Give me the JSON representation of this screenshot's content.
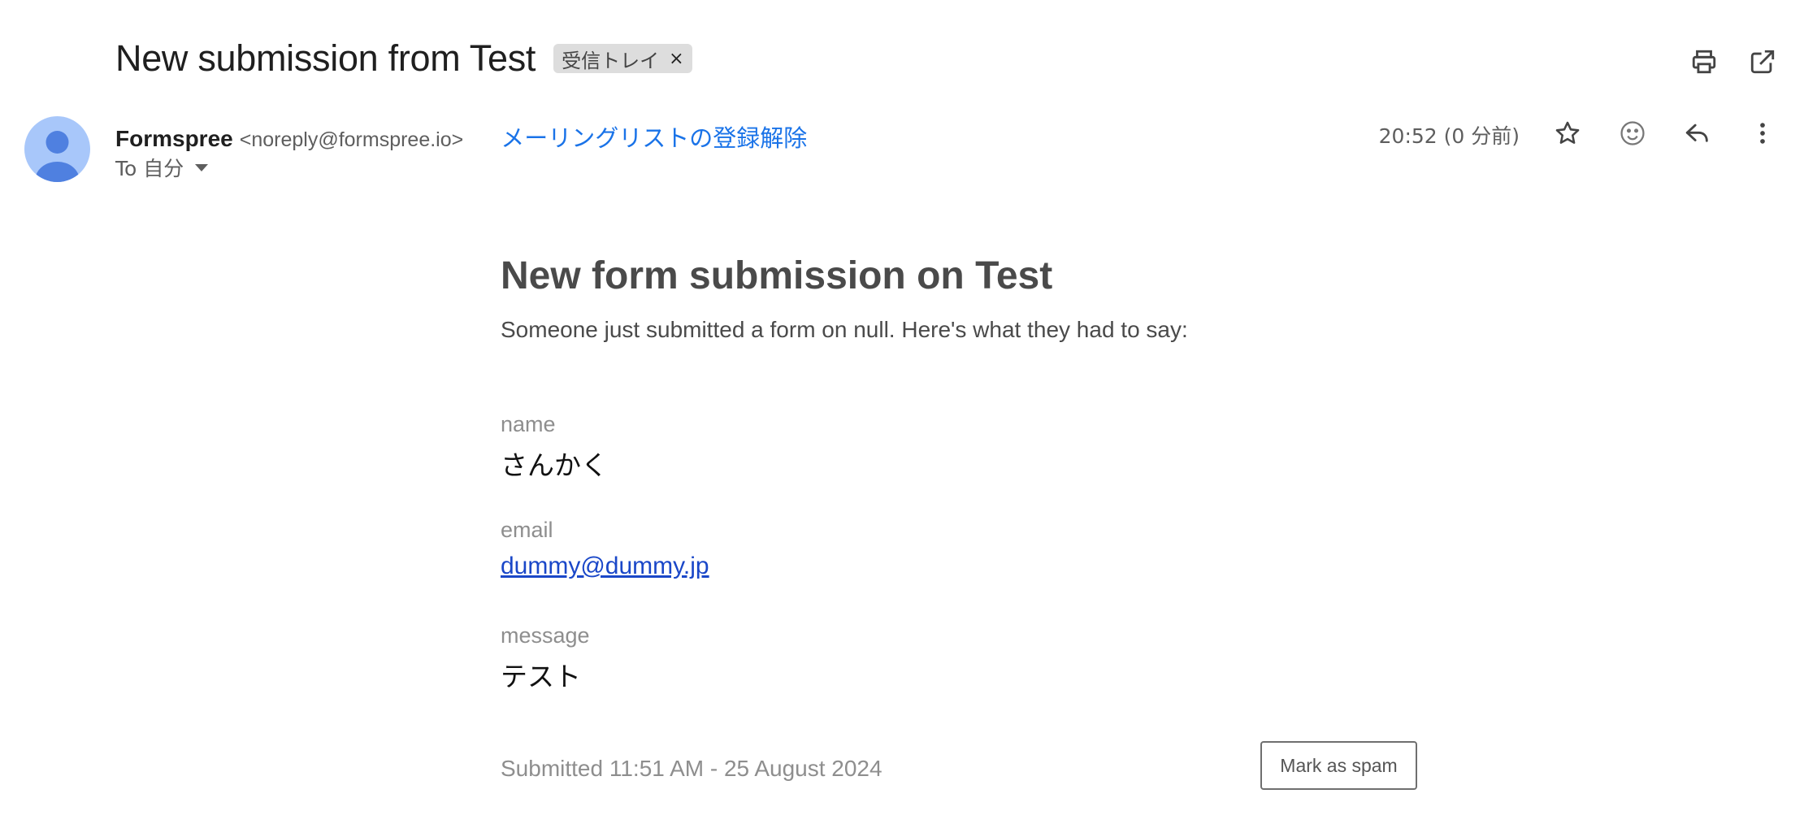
{
  "email": {
    "subject": "New submission from Test",
    "label_chip": {
      "text": "受信トレイ",
      "remove": "×"
    },
    "sender": {
      "name": "Formspree",
      "address": "<noreply@formspree.io>",
      "unsubscribe": "メーリングリストの登録解除"
    },
    "recipient": "To 自分",
    "timestamp": "20:52 (0 分前)"
  },
  "icons": {
    "print": "printer-icon",
    "new_window": "open-in-new-window-icon",
    "star": "star-icon",
    "emoji": "emoji-reaction-icon",
    "reply": "reply-icon",
    "more": "more-vert-icon",
    "avatar": "default-avatar-icon",
    "dropdown": "caret-down-icon"
  },
  "body": {
    "title": "New form submission on Test",
    "intro": "Someone just submitted a form on null. Here's what they had to say:",
    "fields": [
      {
        "label": "name",
        "value": "さんかく"
      },
      {
        "label": "email",
        "value": "dummy@dummy.jp"
      },
      {
        "label": "message",
        "value": "テスト"
      }
    ],
    "submitted": "Submitted 11:51 AM - 25 August 2024",
    "spam_button": "Mark as spam"
  },
  "colors": {
    "link_blue": "#1a73e8",
    "email_link": "#1a47c8",
    "avatar_bg": "#a8c7fa",
    "avatar_fg": "#4f80e0",
    "chip_bg": "#dddddd"
  }
}
